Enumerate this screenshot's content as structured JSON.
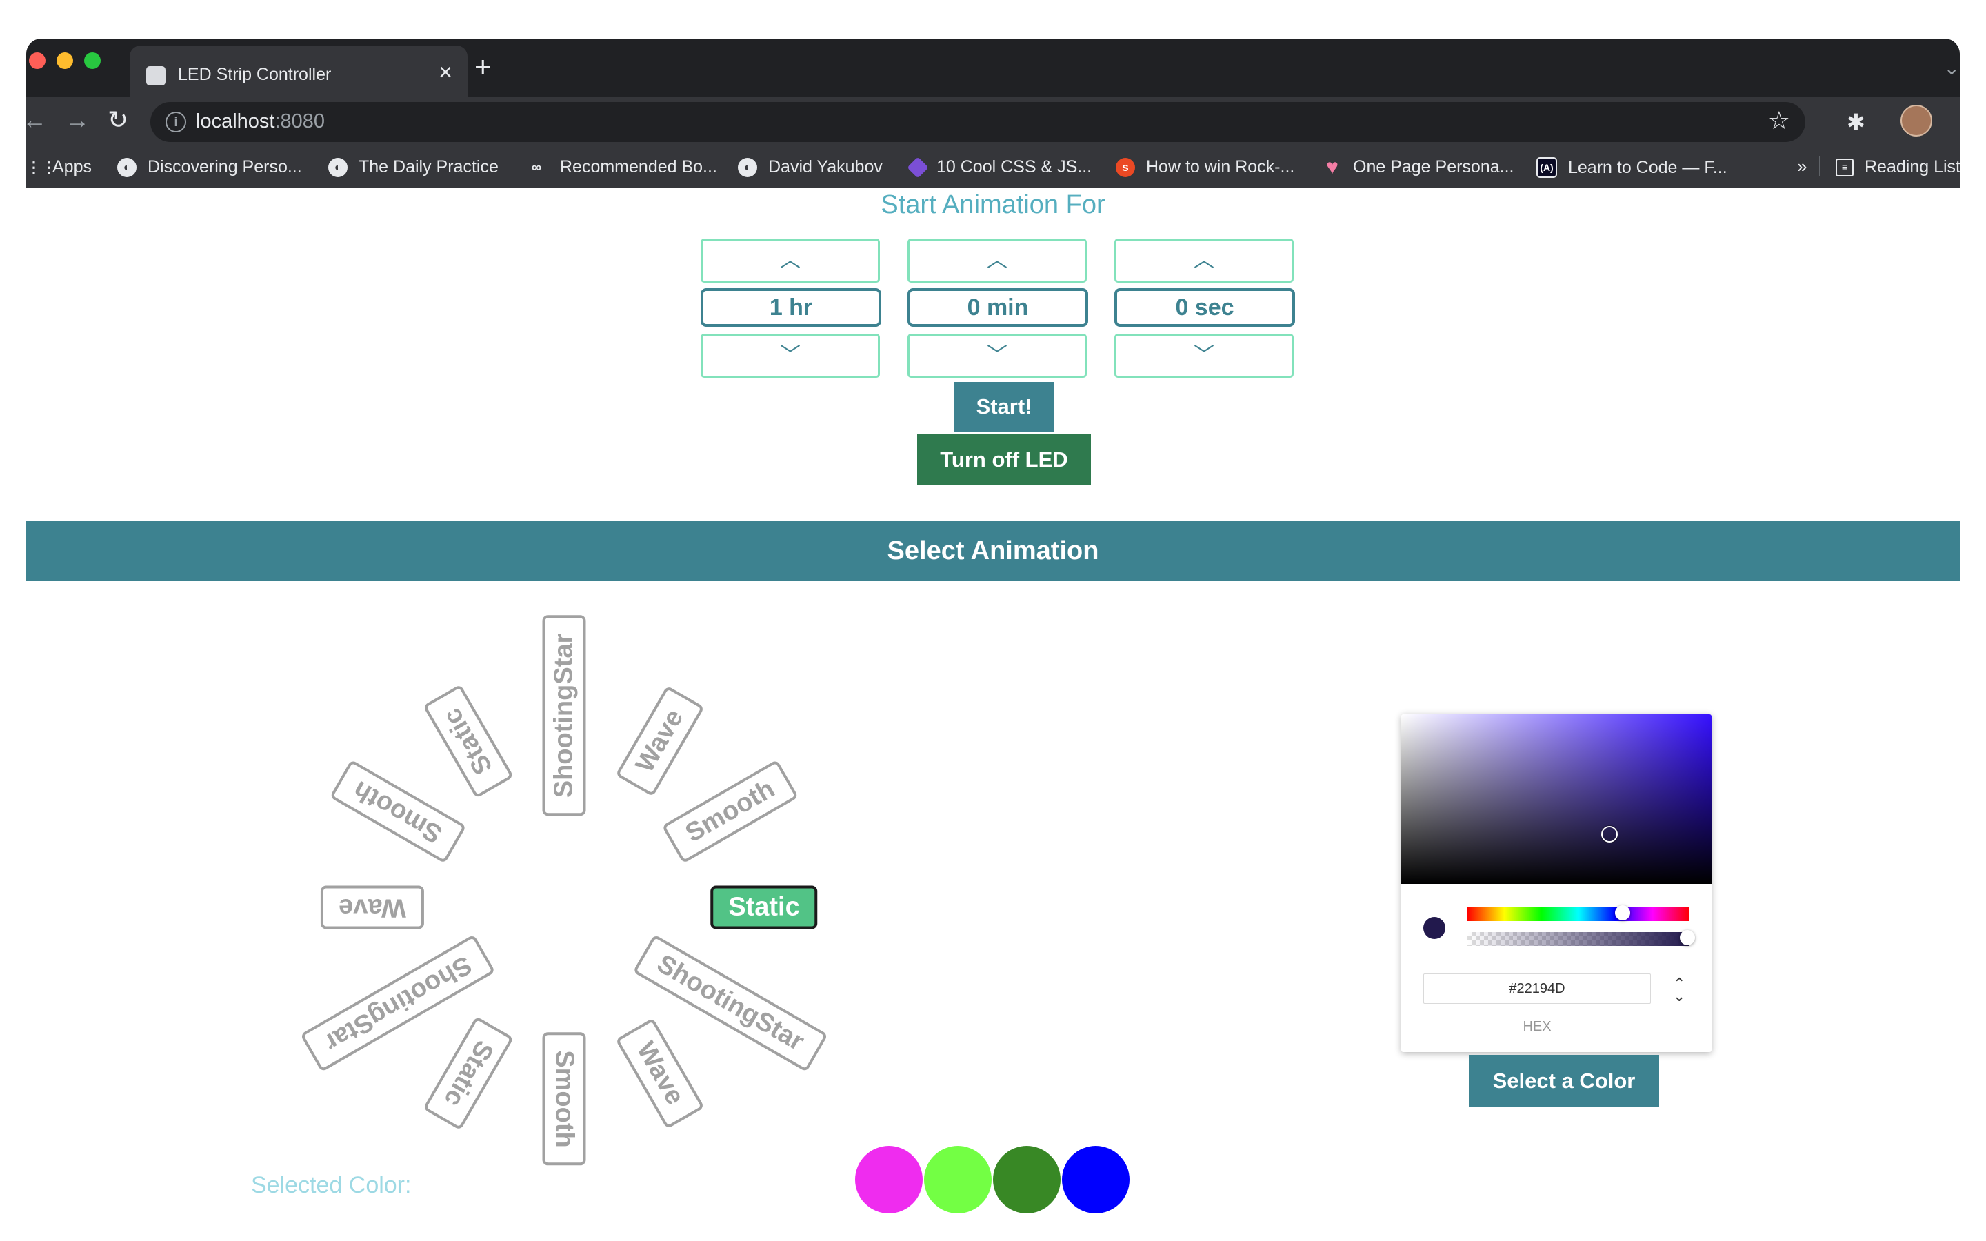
{
  "browser": {
    "tab_title": "LED Strip Controller",
    "tab_close": "×",
    "new_tab": "+",
    "url_host": "localhost",
    "url_port": ":8080",
    "bookmarks": [
      {
        "label": "Apps",
        "icon": "apps-icon"
      },
      {
        "label": "Discovering Perso...",
        "icon": "globe-icon"
      },
      {
        "label": "The Daily Practice",
        "icon": "globe-icon"
      },
      {
        "label": "Recommended Bo...",
        "icon": "glasses-icon"
      },
      {
        "label": "David Yakubov",
        "icon": "globe-icon"
      },
      {
        "label": "10 Cool CSS & JS...",
        "icon": "css-icon"
      },
      {
        "label": "How to win Rock-...",
        "icon": "stumble-icon"
      },
      {
        "label": "One Page Persona...",
        "icon": "heart-icon"
      },
      {
        "label": "Learn to Code — F...",
        "icon": "code-icon"
      }
    ],
    "bookmarks_more": "»",
    "reading_list": "Reading List"
  },
  "timer": {
    "heading": "Start Animation For",
    "up_label": "︿",
    "down_label": "﹀",
    "hours": "1 hr",
    "minutes": "0 min",
    "seconds": "0 sec",
    "start_label": "Start!",
    "off_label": "Turn off LED"
  },
  "animation": {
    "bar_title": "Select Animation",
    "wheel": [
      {
        "label": "Static",
        "active": true
      },
      {
        "label": "ShootingStar",
        "active": false
      },
      {
        "label": "Wave",
        "active": false
      },
      {
        "label": "Smooth",
        "active": false
      },
      {
        "label": "Static",
        "active": false
      },
      {
        "label": "ShootingStar",
        "active": false
      },
      {
        "label": "Wave",
        "active": false
      },
      {
        "label": "Smooth",
        "active": false
      },
      {
        "label": "Static",
        "active": false
      },
      {
        "label": "ShootingStar",
        "active": false
      },
      {
        "label": "Wave",
        "active": false
      },
      {
        "label": "Smooth",
        "active": false
      }
    ]
  },
  "color_picker": {
    "hex_value": "#22194D",
    "hex_label": "HEX",
    "toggle_label": "⌃⌄",
    "button_label": "Select a Color",
    "current_color": "#22194D"
  },
  "selected": {
    "label": "Selected Color:",
    "colors": [
      "#EF2CEF",
      "#73FF44",
      "#388825",
      "#0000FF"
    ]
  }
}
